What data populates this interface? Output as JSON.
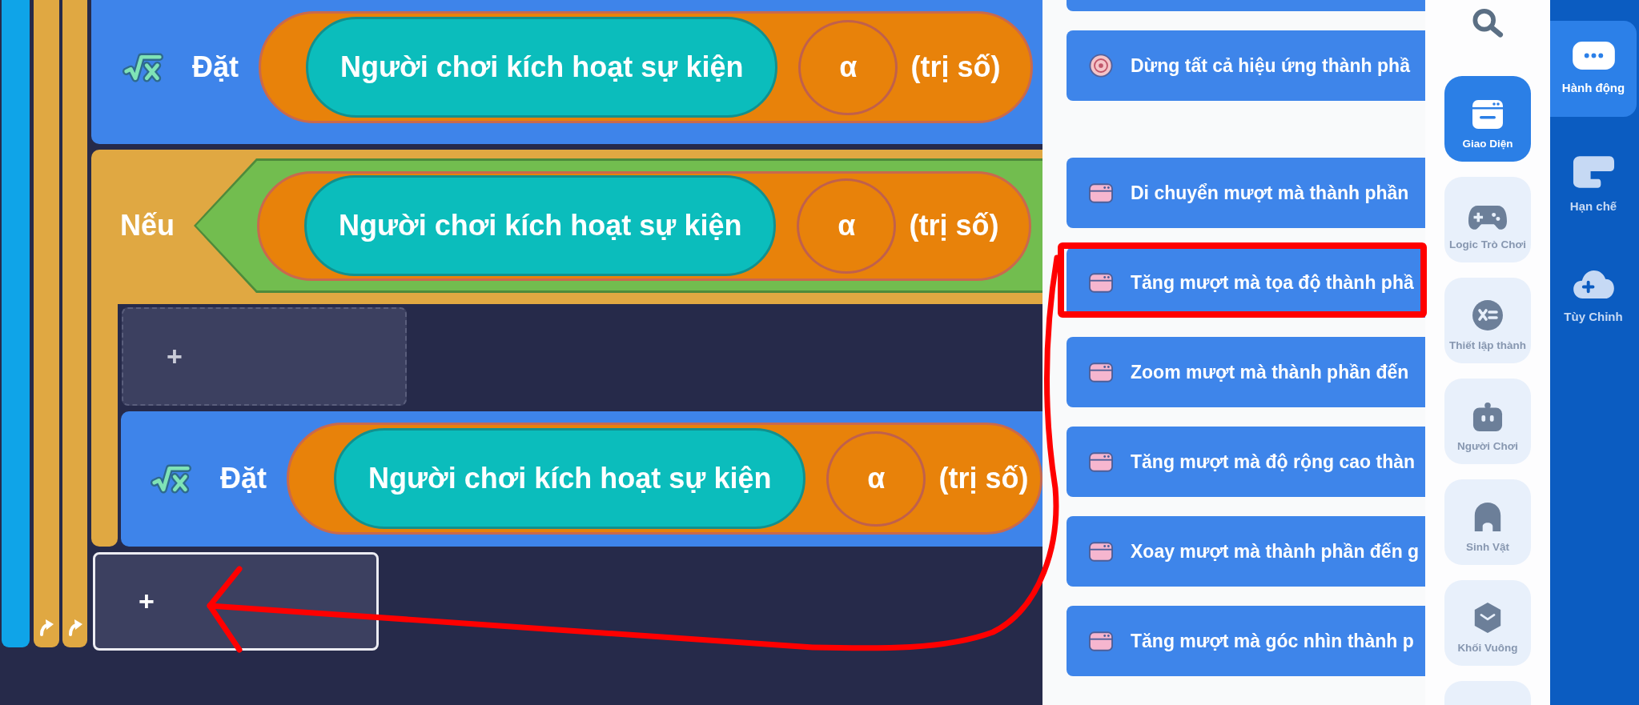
{
  "canvas": {
    "blocks": [
      {
        "kind": "set",
        "keyword": "Đặt",
        "event": "Người chơi kích hoạt sự kiện",
        "param": "α",
        "suffix": "(trị số)"
      },
      {
        "kind": "if",
        "keyword": "Nếu",
        "condition": {
          "event": "Người chơi kích hoạt sự kiện",
          "param": "α",
          "suffix": "(trị số)"
        },
        "body": [
          {
            "kind": "slot",
            "label": "+",
            "selected": false
          },
          {
            "kind": "set",
            "keyword": "Đặt",
            "event": "Người chơi kích hoạt sự kiện",
            "param": "α",
            "suffix": "(trị số)"
          }
        ]
      },
      {
        "kind": "slot",
        "label": "+",
        "selected": true
      }
    ]
  },
  "block_panel": {
    "sections": [
      {
        "items": [
          {
            "kind": "partial",
            "highlighted": false
          },
          {
            "kind": "stop",
            "label": "Dừng tất cả hiệu ứng thành phầ",
            "highlighted": false
          }
        ]
      },
      {
        "items": [
          {
            "kind": "tween",
            "label": "Di chuyển mượt mà thành phần",
            "highlighted": false
          },
          {
            "kind": "tween",
            "label": "Tăng mượt mà tọa độ thành phầ",
            "highlighted": true
          },
          {
            "kind": "tween",
            "label": "Zoom mượt mà thành phần đến",
            "highlighted": false
          },
          {
            "kind": "tween",
            "label": "Tăng mượt mà độ rộng cao thàn",
            "highlighted": false
          },
          {
            "kind": "tween",
            "label": "Xoay mượt mà thành phần đến g",
            "highlighted": false
          },
          {
            "kind": "tween",
            "label": "Tăng mượt mà góc nhìn thành p",
            "highlighted": false
          }
        ]
      }
    ]
  },
  "category_rail": {
    "categories": [
      {
        "label": "Giao Diện",
        "selected": true
      },
      {
        "label": "Logic Trò Chơi",
        "selected": false
      },
      {
        "label": "Thiết lập thành",
        "selected": false
      },
      {
        "label": "Người Chơi",
        "selected": false
      },
      {
        "label": "Sinh Vật",
        "selected": false
      },
      {
        "label": "Khối Vuông",
        "selected": false
      },
      {
        "selected": false
      }
    ]
  },
  "tab_rail": {
    "tabs": [
      {
        "label": "Hành động",
        "selected": true
      },
      {
        "label": "Hạn chế",
        "selected": false
      },
      {
        "label": "Tùy Chỉnh",
        "selected": false
      }
    ]
  }
}
